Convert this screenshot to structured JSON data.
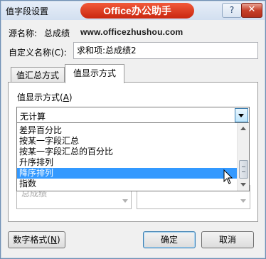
{
  "dialog": {
    "title": "值字段设置",
    "help_label": "?",
    "close_label": "✕"
  },
  "watermark": {
    "logo_text": "Office办公助手",
    "url": "www.officezhushou.com"
  },
  "source": {
    "label": "源名称:",
    "value": "总成绩"
  },
  "custom_name": {
    "label": "自定义名称(C):",
    "value": "求和项:总成绩2"
  },
  "tabs": [
    {
      "label": "值汇总方式",
      "active": false
    },
    {
      "label": "值显示方式",
      "active": true
    }
  ],
  "display": {
    "label_prefix": "值显示方式(",
    "label_key": "A",
    "label_suffix": ")",
    "selected_value": "无计算",
    "options": [
      {
        "label": "差异百分比",
        "selected": false
      },
      {
        "label": "按某一字段汇总",
        "selected": false
      },
      {
        "label": "按某一字段汇总的百分比",
        "selected": false
      },
      {
        "label": "升序排列",
        "selected": false
      },
      {
        "label": "降序排列",
        "selected": true
      },
      {
        "label": "指数",
        "selected": false
      }
    ]
  },
  "base": {
    "partial_item": "总成绩"
  },
  "buttons": {
    "number_format_prefix": "数字格式(",
    "number_format_key": "N",
    "number_format_suffix": ")",
    "ok": "确定",
    "cancel": "取消"
  },
  "colors": {
    "selection": "#3399ff",
    "close_button": "#c7402a",
    "logo_background": "#d9361b"
  }
}
